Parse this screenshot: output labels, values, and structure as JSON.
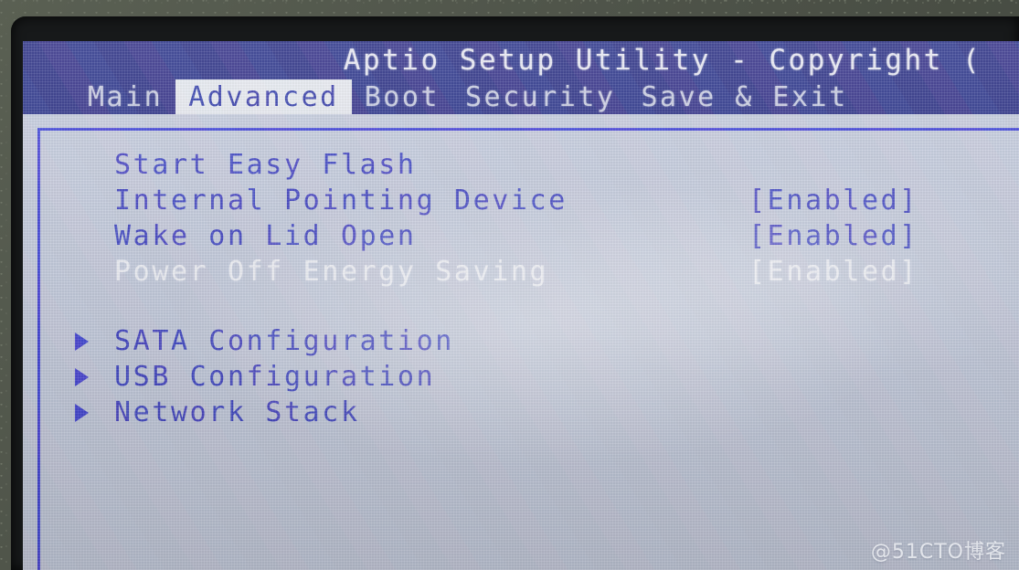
{
  "window": {
    "title": "Aptio Setup Utility - Copyright (",
    "watermark": "@51CTO博客"
  },
  "colors": {
    "header_blue": "#252b86",
    "screen_bg": "#c5ccdf",
    "text_blue": "#3b3fc4",
    "frame_blue": "#3a3ddb",
    "active_tab_bg": "#e7ebf2",
    "inactive_tab_text": "#c9cde4",
    "bezel": "#17191a"
  },
  "tabs": [
    {
      "label": "Main",
      "active": false
    },
    {
      "label": "Advanced",
      "active": true
    },
    {
      "label": "Boot",
      "active": false
    },
    {
      "label": "Security",
      "active": false
    },
    {
      "label": "Save & Exit",
      "active": false
    }
  ],
  "menu": {
    "items": [
      {
        "label": "Start Easy Flash",
        "value": "",
        "submenu": false,
        "bright": false
      },
      {
        "label": "Internal Pointing Device",
        "value": "[Enabled]",
        "submenu": false,
        "bright": false
      },
      {
        "label": "Wake on Lid Open",
        "value": "[Enabled]",
        "submenu": false,
        "bright": false
      },
      {
        "label": "Power Off Energy Saving",
        "value": "[Enabled]",
        "submenu": false,
        "bright": true
      },
      {
        "label": "SATA Configuration",
        "value": "",
        "submenu": true,
        "bright": false
      },
      {
        "label": "USB Configuration",
        "value": "",
        "submenu": true,
        "bright": false
      },
      {
        "label": "Network Stack",
        "value": "",
        "submenu": true,
        "bright": false
      }
    ],
    "spacer_after_index": 3
  },
  "icons": {
    "submenu_arrow": "submenu-arrow-icon"
  }
}
